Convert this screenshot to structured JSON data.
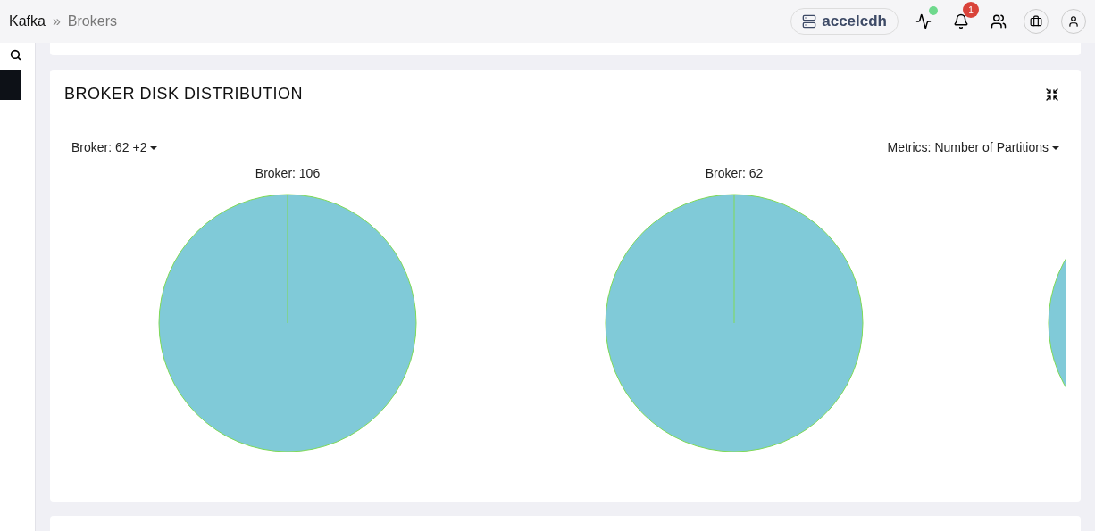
{
  "breadcrumb": [
    {
      "label": "Kafka",
      "selected": false
    },
    {
      "label": "Brokers",
      "selected": true
    }
  ],
  "breadcrumb_separator": "»",
  "cluster": {
    "name": "accelcdh"
  },
  "status": {
    "online": true
  },
  "notifications": {
    "count": "1"
  },
  "card": {
    "title": "BROKER DISK DISTRIBUTION",
    "broker_filter": "Broker: 62 +2",
    "metrics_filter": "Metrics: Number of Partitions",
    "pies": [
      {
        "title": "Broker: 106"
      },
      {
        "title": "Broker: 62"
      }
    ]
  }
}
